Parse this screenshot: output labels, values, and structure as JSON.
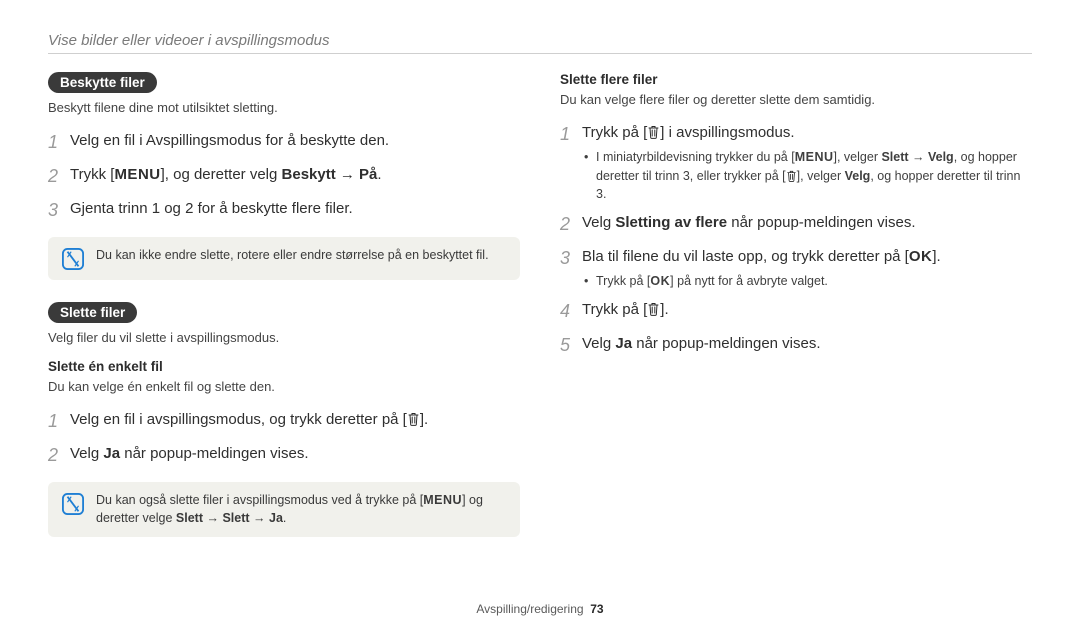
{
  "page_title": "Vise bilder eller videoer i avspillingsmodus",
  "footer": {
    "section": "Avspilling/redigering",
    "page": "73"
  },
  "key": {
    "menu": "MENU",
    "ok": "OK"
  },
  "left": {
    "protect": {
      "pill": "Beskytte filer",
      "lead": "Beskytt filene dine mot utilsiktet sletting.",
      "step1": "Velg en fil i Avspillingsmodus for å beskytte den.",
      "step2_a": "Trykk [",
      "step2_b": "], og deretter velg ",
      "step2_c": "Beskytt → På",
      "step2_d": ".",
      "step3": "Gjenta trinn 1 og 2 for å beskytte flere filer.",
      "note": "Du kan ikke endre slette, rotere eller endre størrelse på en beskyttet fil."
    },
    "delete": {
      "pill": "Slette filer",
      "lead": "Velg filer du vil slette i avspillingsmodus.",
      "sub1_title": "Slette én enkelt fil",
      "sub1_lead": "Du kan velge én enkelt fil og slette den.",
      "s1_a": "Velg en fil i avspillingsmodus, og trykk deretter på [",
      "s1_b": "].",
      "s2_a": "Velg ",
      "s2_b": "Ja",
      "s2_c": " når popup-meldingen vises.",
      "note_a": "Du kan også slette filer i avspillingsmodus ved å trykke på [",
      "note_b": "] og deretter velge ",
      "note_c": "Slett → Slett → Ja",
      "note_d": "."
    }
  },
  "right": {
    "title": "Slette flere filer",
    "lead": "Du kan velge flere filer og deretter slette dem samtidig.",
    "s1_a": "Trykk på  [",
    "s1_b": "] i avspillingsmodus.",
    "s1_bullet_a": "I miniatyrbildevisning trykker du på [",
    "s1_bullet_b": "], velger ",
    "s1_bullet_c": "Slett → Velg",
    "s1_bullet_d": ", og hopper deretter til trinn 3, eller trykker på [",
    "s1_bullet_e": "], velger ",
    "s1_bullet_f": "Velg",
    "s1_bullet_g": ", og hopper deretter til trinn 3.",
    "s2_a": "Velg ",
    "s2_b": "Sletting av flere",
    "s2_c": " når popup-meldingen vises.",
    "s3_a": "Bla til filene du vil laste opp, og trykk deretter på [",
    "s3_b": "].",
    "s3_bullet_a": "Trykk på [",
    "s3_bullet_b": "] på nytt for å avbryte valget.",
    "s4_a": "Trykk på [",
    "s4_b": "].",
    "s5_a": "Velg ",
    "s5_b": "Ja",
    "s5_c": " når popup-meldingen vises."
  }
}
